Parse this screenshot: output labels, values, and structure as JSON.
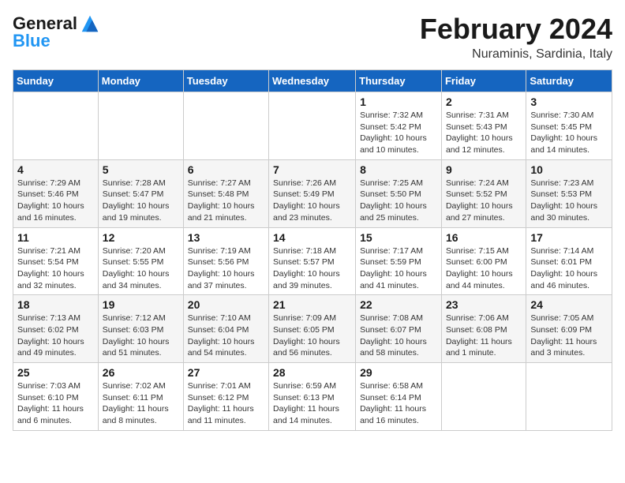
{
  "logo": {
    "line1": "General",
    "line2": "Blue"
  },
  "title": "February 2024",
  "subtitle": "Nuraminis, Sardinia, Italy",
  "days_of_week": [
    "Sunday",
    "Monday",
    "Tuesday",
    "Wednesday",
    "Thursday",
    "Friday",
    "Saturday"
  ],
  "weeks": [
    [
      {
        "num": "",
        "info": ""
      },
      {
        "num": "",
        "info": ""
      },
      {
        "num": "",
        "info": ""
      },
      {
        "num": "",
        "info": ""
      },
      {
        "num": "1",
        "info": "Sunrise: 7:32 AM\nSunset: 5:42 PM\nDaylight: 10 hours\nand 10 minutes."
      },
      {
        "num": "2",
        "info": "Sunrise: 7:31 AM\nSunset: 5:43 PM\nDaylight: 10 hours\nand 12 minutes."
      },
      {
        "num": "3",
        "info": "Sunrise: 7:30 AM\nSunset: 5:45 PM\nDaylight: 10 hours\nand 14 minutes."
      }
    ],
    [
      {
        "num": "4",
        "info": "Sunrise: 7:29 AM\nSunset: 5:46 PM\nDaylight: 10 hours\nand 16 minutes."
      },
      {
        "num": "5",
        "info": "Sunrise: 7:28 AM\nSunset: 5:47 PM\nDaylight: 10 hours\nand 19 minutes."
      },
      {
        "num": "6",
        "info": "Sunrise: 7:27 AM\nSunset: 5:48 PM\nDaylight: 10 hours\nand 21 minutes."
      },
      {
        "num": "7",
        "info": "Sunrise: 7:26 AM\nSunset: 5:49 PM\nDaylight: 10 hours\nand 23 minutes."
      },
      {
        "num": "8",
        "info": "Sunrise: 7:25 AM\nSunset: 5:50 PM\nDaylight: 10 hours\nand 25 minutes."
      },
      {
        "num": "9",
        "info": "Sunrise: 7:24 AM\nSunset: 5:52 PM\nDaylight: 10 hours\nand 27 minutes."
      },
      {
        "num": "10",
        "info": "Sunrise: 7:23 AM\nSunset: 5:53 PM\nDaylight: 10 hours\nand 30 minutes."
      }
    ],
    [
      {
        "num": "11",
        "info": "Sunrise: 7:21 AM\nSunset: 5:54 PM\nDaylight: 10 hours\nand 32 minutes."
      },
      {
        "num": "12",
        "info": "Sunrise: 7:20 AM\nSunset: 5:55 PM\nDaylight: 10 hours\nand 34 minutes."
      },
      {
        "num": "13",
        "info": "Sunrise: 7:19 AM\nSunset: 5:56 PM\nDaylight: 10 hours\nand 37 minutes."
      },
      {
        "num": "14",
        "info": "Sunrise: 7:18 AM\nSunset: 5:57 PM\nDaylight: 10 hours\nand 39 minutes."
      },
      {
        "num": "15",
        "info": "Sunrise: 7:17 AM\nSunset: 5:59 PM\nDaylight: 10 hours\nand 41 minutes."
      },
      {
        "num": "16",
        "info": "Sunrise: 7:15 AM\nSunset: 6:00 PM\nDaylight: 10 hours\nand 44 minutes."
      },
      {
        "num": "17",
        "info": "Sunrise: 7:14 AM\nSunset: 6:01 PM\nDaylight: 10 hours\nand 46 minutes."
      }
    ],
    [
      {
        "num": "18",
        "info": "Sunrise: 7:13 AM\nSunset: 6:02 PM\nDaylight: 10 hours\nand 49 minutes."
      },
      {
        "num": "19",
        "info": "Sunrise: 7:12 AM\nSunset: 6:03 PM\nDaylight: 10 hours\nand 51 minutes."
      },
      {
        "num": "20",
        "info": "Sunrise: 7:10 AM\nSunset: 6:04 PM\nDaylight: 10 hours\nand 54 minutes."
      },
      {
        "num": "21",
        "info": "Sunrise: 7:09 AM\nSunset: 6:05 PM\nDaylight: 10 hours\nand 56 minutes."
      },
      {
        "num": "22",
        "info": "Sunrise: 7:08 AM\nSunset: 6:07 PM\nDaylight: 10 hours\nand 58 minutes."
      },
      {
        "num": "23",
        "info": "Sunrise: 7:06 AM\nSunset: 6:08 PM\nDaylight: 11 hours\nand 1 minute."
      },
      {
        "num": "24",
        "info": "Sunrise: 7:05 AM\nSunset: 6:09 PM\nDaylight: 11 hours\nand 3 minutes."
      }
    ],
    [
      {
        "num": "25",
        "info": "Sunrise: 7:03 AM\nSunset: 6:10 PM\nDaylight: 11 hours\nand 6 minutes."
      },
      {
        "num": "26",
        "info": "Sunrise: 7:02 AM\nSunset: 6:11 PM\nDaylight: 11 hours\nand 8 minutes."
      },
      {
        "num": "27",
        "info": "Sunrise: 7:01 AM\nSunset: 6:12 PM\nDaylight: 11 hours\nand 11 minutes."
      },
      {
        "num": "28",
        "info": "Sunrise: 6:59 AM\nSunset: 6:13 PM\nDaylight: 11 hours\nand 14 minutes."
      },
      {
        "num": "29",
        "info": "Sunrise: 6:58 AM\nSunset: 6:14 PM\nDaylight: 11 hours\nand 16 minutes."
      },
      {
        "num": "",
        "info": ""
      },
      {
        "num": "",
        "info": ""
      }
    ]
  ]
}
